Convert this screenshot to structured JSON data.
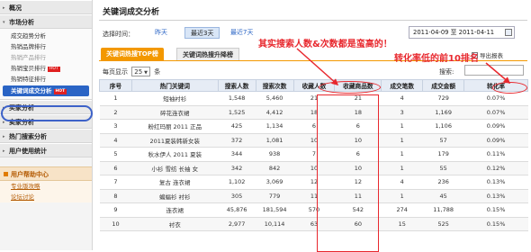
{
  "sidebar": {
    "sections": [
      {
        "label": "概况"
      },
      {
        "label": "市场分析",
        "items": [
          {
            "label": "成交趋势分析",
            "dim": false,
            "hot": false
          },
          {
            "label": "热销品牌排行",
            "dim": false,
            "hot": false
          },
          {
            "label": "热销产品排行",
            "dim": true,
            "hot": false
          },
          {
            "label": "热销宝贝排行",
            "dim": false,
            "hot": true
          },
          {
            "label": "热销特征排行",
            "dim": false,
            "hot": false
          }
        ]
      }
    ],
    "active_item": "关键词成交分析",
    "hot_badge": "HOT",
    "more_sections": [
      {
        "label": "买家分析"
      },
      {
        "label": "卖家分析"
      },
      {
        "label": "热门搜索分析"
      },
      {
        "label": "用户使用统计"
      }
    ],
    "help": {
      "title": "用户帮助中心",
      "items": [
        "专业版攻略",
        "论坛讨论"
      ]
    }
  },
  "header": {
    "title": "关键词成交分析"
  },
  "range": {
    "label": "选择时间：",
    "options": [
      "昨天",
      "最近3天",
      "最近7天"
    ],
    "selected": "最近3天",
    "date_range": "2011-04-09 至 2011-04-11"
  },
  "tabs": [
    {
      "label": "关键词热搜TOP榜",
      "active": true
    },
    {
      "label": "关键词热搜升降榜",
      "active": false
    }
  ],
  "export_label": "导出报表",
  "paging": {
    "prefix": "每页显示",
    "value": "25",
    "suffix": "条"
  },
  "search": {
    "label": "搜索:",
    "placeholder": ""
  },
  "table": {
    "columns": [
      "序号",
      "热门关键词",
      "搜索人数",
      "搜索次数",
      "收藏人数",
      "收藏商品数",
      "成交笔数",
      "成交金额",
      "转化率"
    ],
    "rows": [
      [
        "1",
        "短袖衬衫",
        "1,548",
        "5,460",
        "21",
        "21",
        "4",
        "729",
        "0.07%"
      ],
      [
        "2",
        "碎花连衣裙",
        "1,525",
        "4,412",
        "18",
        "18",
        "3",
        "1,169",
        "0.07%"
      ],
      [
        "3",
        "粉红玛丽 2011 正品",
        "425",
        "1,134",
        "6",
        "6",
        "1",
        "1,106",
        "0.09%"
      ],
      [
        "4",
        "2011夏装韩新女装",
        "372",
        "1,081",
        "10",
        "10",
        "1",
        "57",
        "0.09%"
      ],
      [
        "5",
        "秋水伊人 2011 夏装",
        "344",
        "938",
        "7",
        "6",
        "1",
        "179",
        "0.11%"
      ],
      [
        "6",
        "小衫 雪纺 长袖 女",
        "342",
        "842",
        "10",
        "10",
        "1",
        "55",
        "0.12%"
      ],
      [
        "7",
        "复古 连衣裙",
        "1,102",
        "3,069",
        "12",
        "12",
        "4",
        "236",
        "0.13%"
      ],
      [
        "8",
        "蝙蝠衫 衬衫",
        "305",
        "779",
        "11",
        "11",
        "1",
        "45",
        "0.13%"
      ],
      [
        "9",
        "连衣裙",
        "45,876",
        "181,594",
        "570",
        "542",
        "274",
        "11,788",
        "0.15%"
      ],
      [
        "10",
        "衬衣",
        "2,977",
        "10,114",
        "63",
        "60",
        "15",
        "525",
        "0.15%"
      ]
    ]
  },
  "annotations": {
    "left": "其实搜索人数&次数都是蛮高的！",
    "right": "转化率低的前10排名"
  },
  "colors": {
    "accent": "#2a64c5",
    "tab_orange": "#f39800",
    "annotation_red": "#e8282e"
  }
}
